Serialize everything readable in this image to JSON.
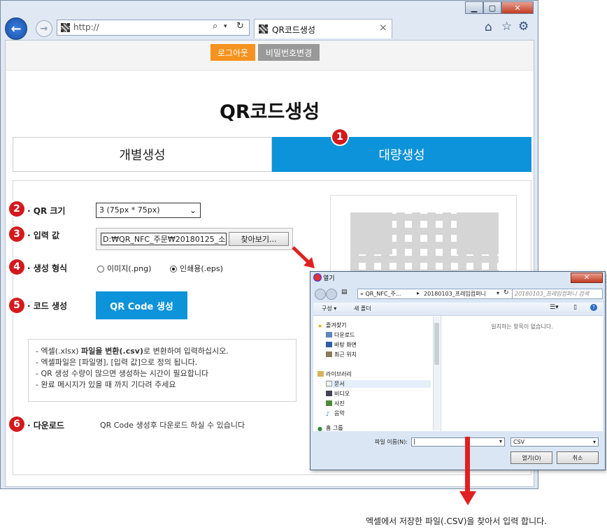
{
  "browser": {
    "address": "http://",
    "tab_title": "QR코드생성",
    "tab_close": "×",
    "controls": {
      "minimize": "▁",
      "maximize": "▢",
      "close": "✕"
    },
    "icons": {
      "back": "back-arrow-icon",
      "forward": "forward-arrow-icon",
      "search": "search-icon",
      "refresh": "refresh-icon",
      "home": "home-icon",
      "star": "star-icon",
      "gear": "gear-icon"
    }
  },
  "header": {
    "logout": "로그아웃",
    "change_password": "비밀번호변경"
  },
  "page": {
    "title": "QR코드생성",
    "tabs": [
      {
        "label": "개별생성",
        "active": false
      },
      {
        "label": "대량생성",
        "active": true
      }
    ]
  },
  "form": {
    "qr_size": {
      "label": "QR 크기",
      "value": "3 (75px * 75px)"
    },
    "input_value": {
      "label": "입력 값",
      "value": "D:₩QR_NFC_주문₩20180125_소",
      "browse": "찾아보기..."
    },
    "format": {
      "label": "생성 형식",
      "options": [
        {
          "label": "이미지(.png)",
          "selected": false
        },
        {
          "label": "인쇄용(.eps)",
          "selected": true
        }
      ]
    },
    "generate": {
      "label": "코드 생성",
      "button": "QR Code 생성"
    },
    "notes_rich": {
      "line1_pre": "- 엑셀(.xlsx) ",
      "line1_bold": "파일을 변환(.csv)",
      "line1_post": "로 변환하여 입력하십시오.",
      "line2": "- 엑셀파일은 [파일명], [입력 값]으로 정의 됩니다.",
      "line3": "- QR 생성 수량이 많으면 생성하는 시간이 필요합니다",
      "line4": "- 완료 메시지가 있을 때 까지 기다려 주세요"
    },
    "download": {
      "label": "다운로드",
      "text": "QR Code 생성후 다운로드 하실 수 있습니다"
    }
  },
  "badges": [
    "1",
    "2",
    "3",
    "4",
    "5",
    "6"
  ],
  "dialog": {
    "title": "열기",
    "path": [
      "« QR_NFC_주...",
      "20180103_프레임컴퍼니"
    ],
    "search_placeholder": "20180103_프레임컴퍼니 검색",
    "organize": "구성 ▾",
    "new_folder": "새 폴더",
    "empty_message": "일치하는 항목이 없습니다.",
    "tree": {
      "favorites": "즐겨찾기",
      "favorites_items": [
        "다운로드",
        "바탕 화면",
        "최근 위치"
      ],
      "libraries": "라이브러리",
      "library_items": [
        "문서",
        "비디오",
        "사진",
        "음악"
      ],
      "homegroup": "홈 그룹"
    },
    "filename_label": "파일 이름(N):",
    "filetype": "CSV",
    "open_button": "열기(O)",
    "cancel_button": "취소"
  },
  "caption": "엑셀에서 저장한 파일(.CSV)을 찾아서 입력 합니다.",
  "colors": {
    "accent_blue": "#0d93d9",
    "orange": "#f6921e",
    "badge_red": "#d4191d",
    "arrow_red": "#e02020"
  }
}
